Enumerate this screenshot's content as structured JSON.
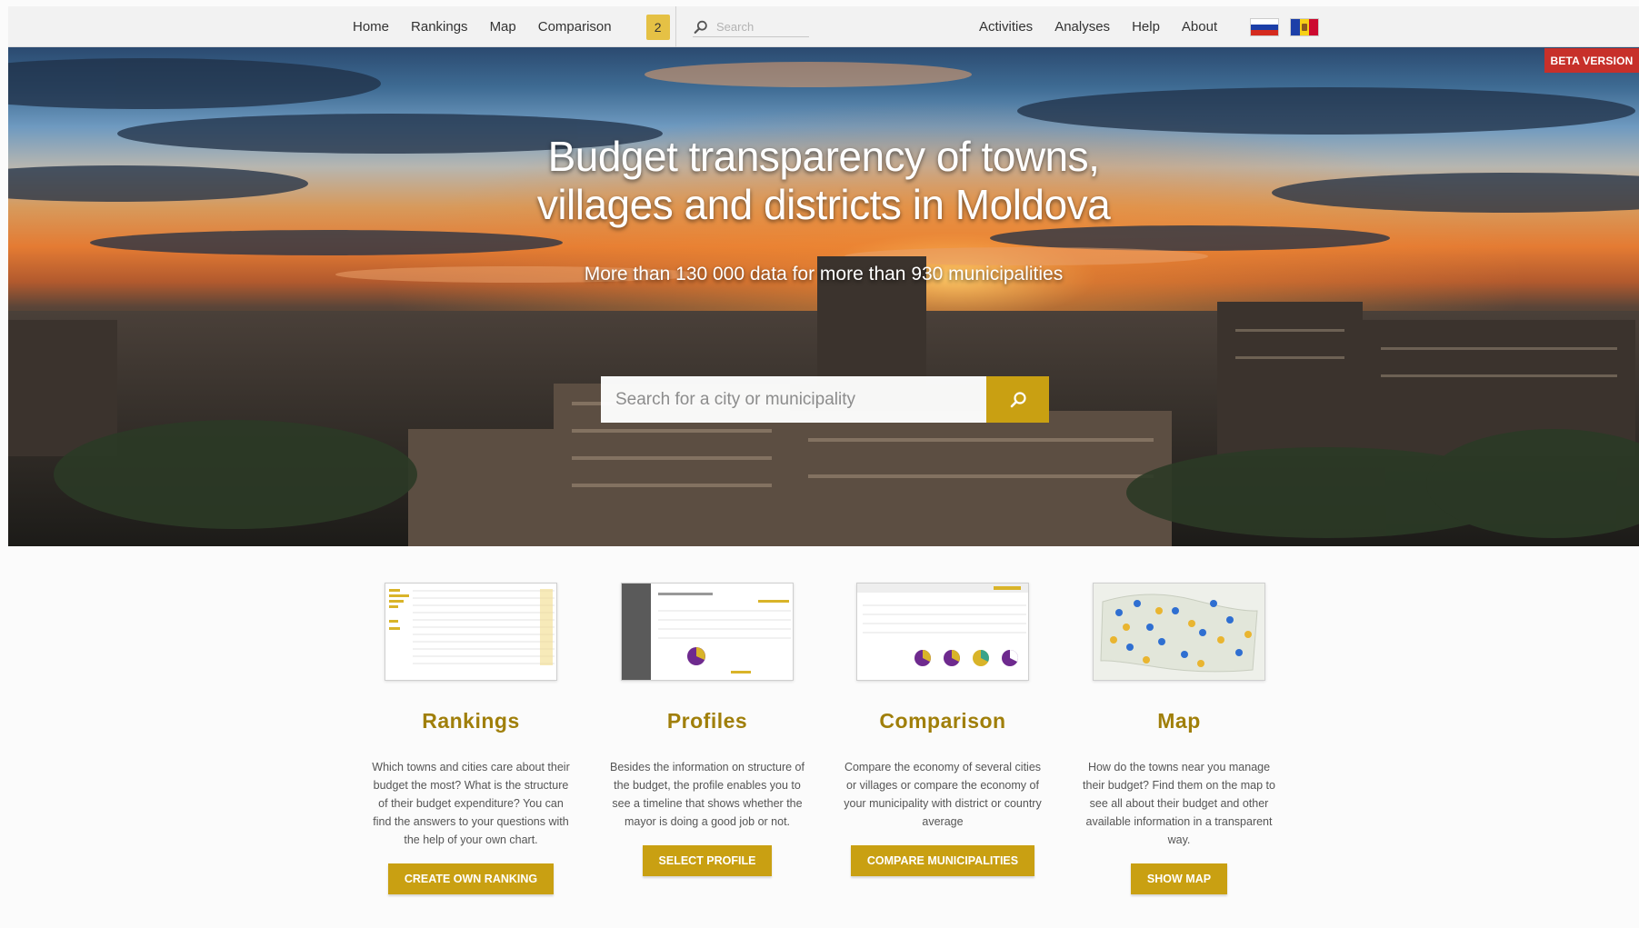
{
  "navbar": {
    "left_links": [
      "Home",
      "Rankings",
      "Map",
      "Comparison"
    ],
    "comparison_count": "2",
    "search_placeholder": "Search",
    "right_links": [
      "Activities",
      "Analyses",
      "Help",
      "About"
    ],
    "languages": [
      "russian-flag",
      "moldovan-flag"
    ]
  },
  "hero": {
    "title_line1": "Budget transparency of towns,",
    "title_line2": "villages and districts in Moldova",
    "subtitle": "More than 130 000 data for more than 930 municipalities",
    "search_placeholder": "Search for a city or municipality",
    "beta_label": "BETA VERSION"
  },
  "features": [
    {
      "title": "Rankings",
      "text": "Which towns and cities care about their budget the most? What is the structure of their budget expenditure? You can find the answers to your questions with the help of your own chart.",
      "button": "CREATE OWN RANKING"
    },
    {
      "title": "Profiles",
      "text": "Besides the information on structure of the budget, the profile enables you to see a timeline that shows whether the mayor is doing a good job or not.",
      "button": "SELECT PROFILE"
    },
    {
      "title": "Comparison",
      "text": "Compare the economy of several cities or villages or compare the economy of your municipality with district or country average",
      "button": "COMPARE MUNICIPALITIES"
    },
    {
      "title": "Map",
      "text": "How do the towns near you manage their budget? Find them on the map to see all about their budget and other available information in a transparent way.",
      "button": "SHOW MAP"
    }
  ],
  "colors": {
    "accent": "#c9a012",
    "heading": "#a07f0a",
    "beta": "#c7302a",
    "badge": "#e5c145"
  }
}
